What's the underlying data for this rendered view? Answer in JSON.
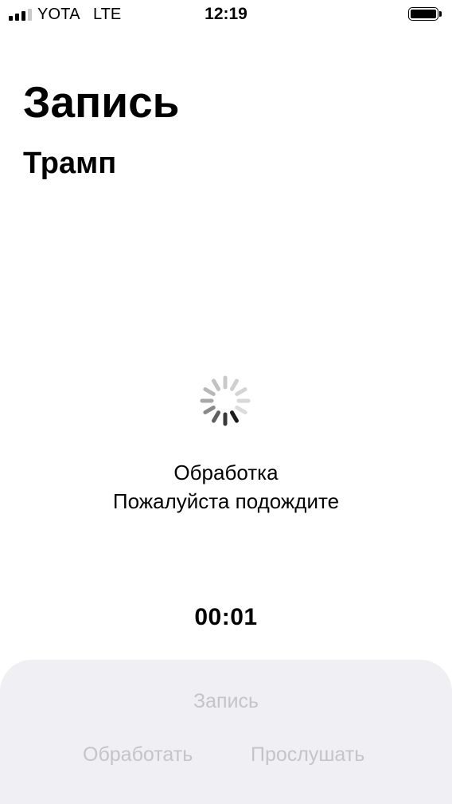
{
  "status_bar": {
    "carrier": "YOTA",
    "network": "LTE",
    "time": "12:19"
  },
  "page": {
    "title": "Запись",
    "subtitle": "Трамп"
  },
  "processing": {
    "title": "Обработка",
    "message": "Пожалуйста подождите",
    "spinner_icon": "activity-spinner-icon"
  },
  "timer": {
    "value": "00:01"
  },
  "actions": {
    "record_label": "Запись",
    "process_label": "Обработать",
    "listen_label": "Прослушать",
    "disabled_color": "#c4c4c9",
    "panel_color": "#efeff4"
  }
}
